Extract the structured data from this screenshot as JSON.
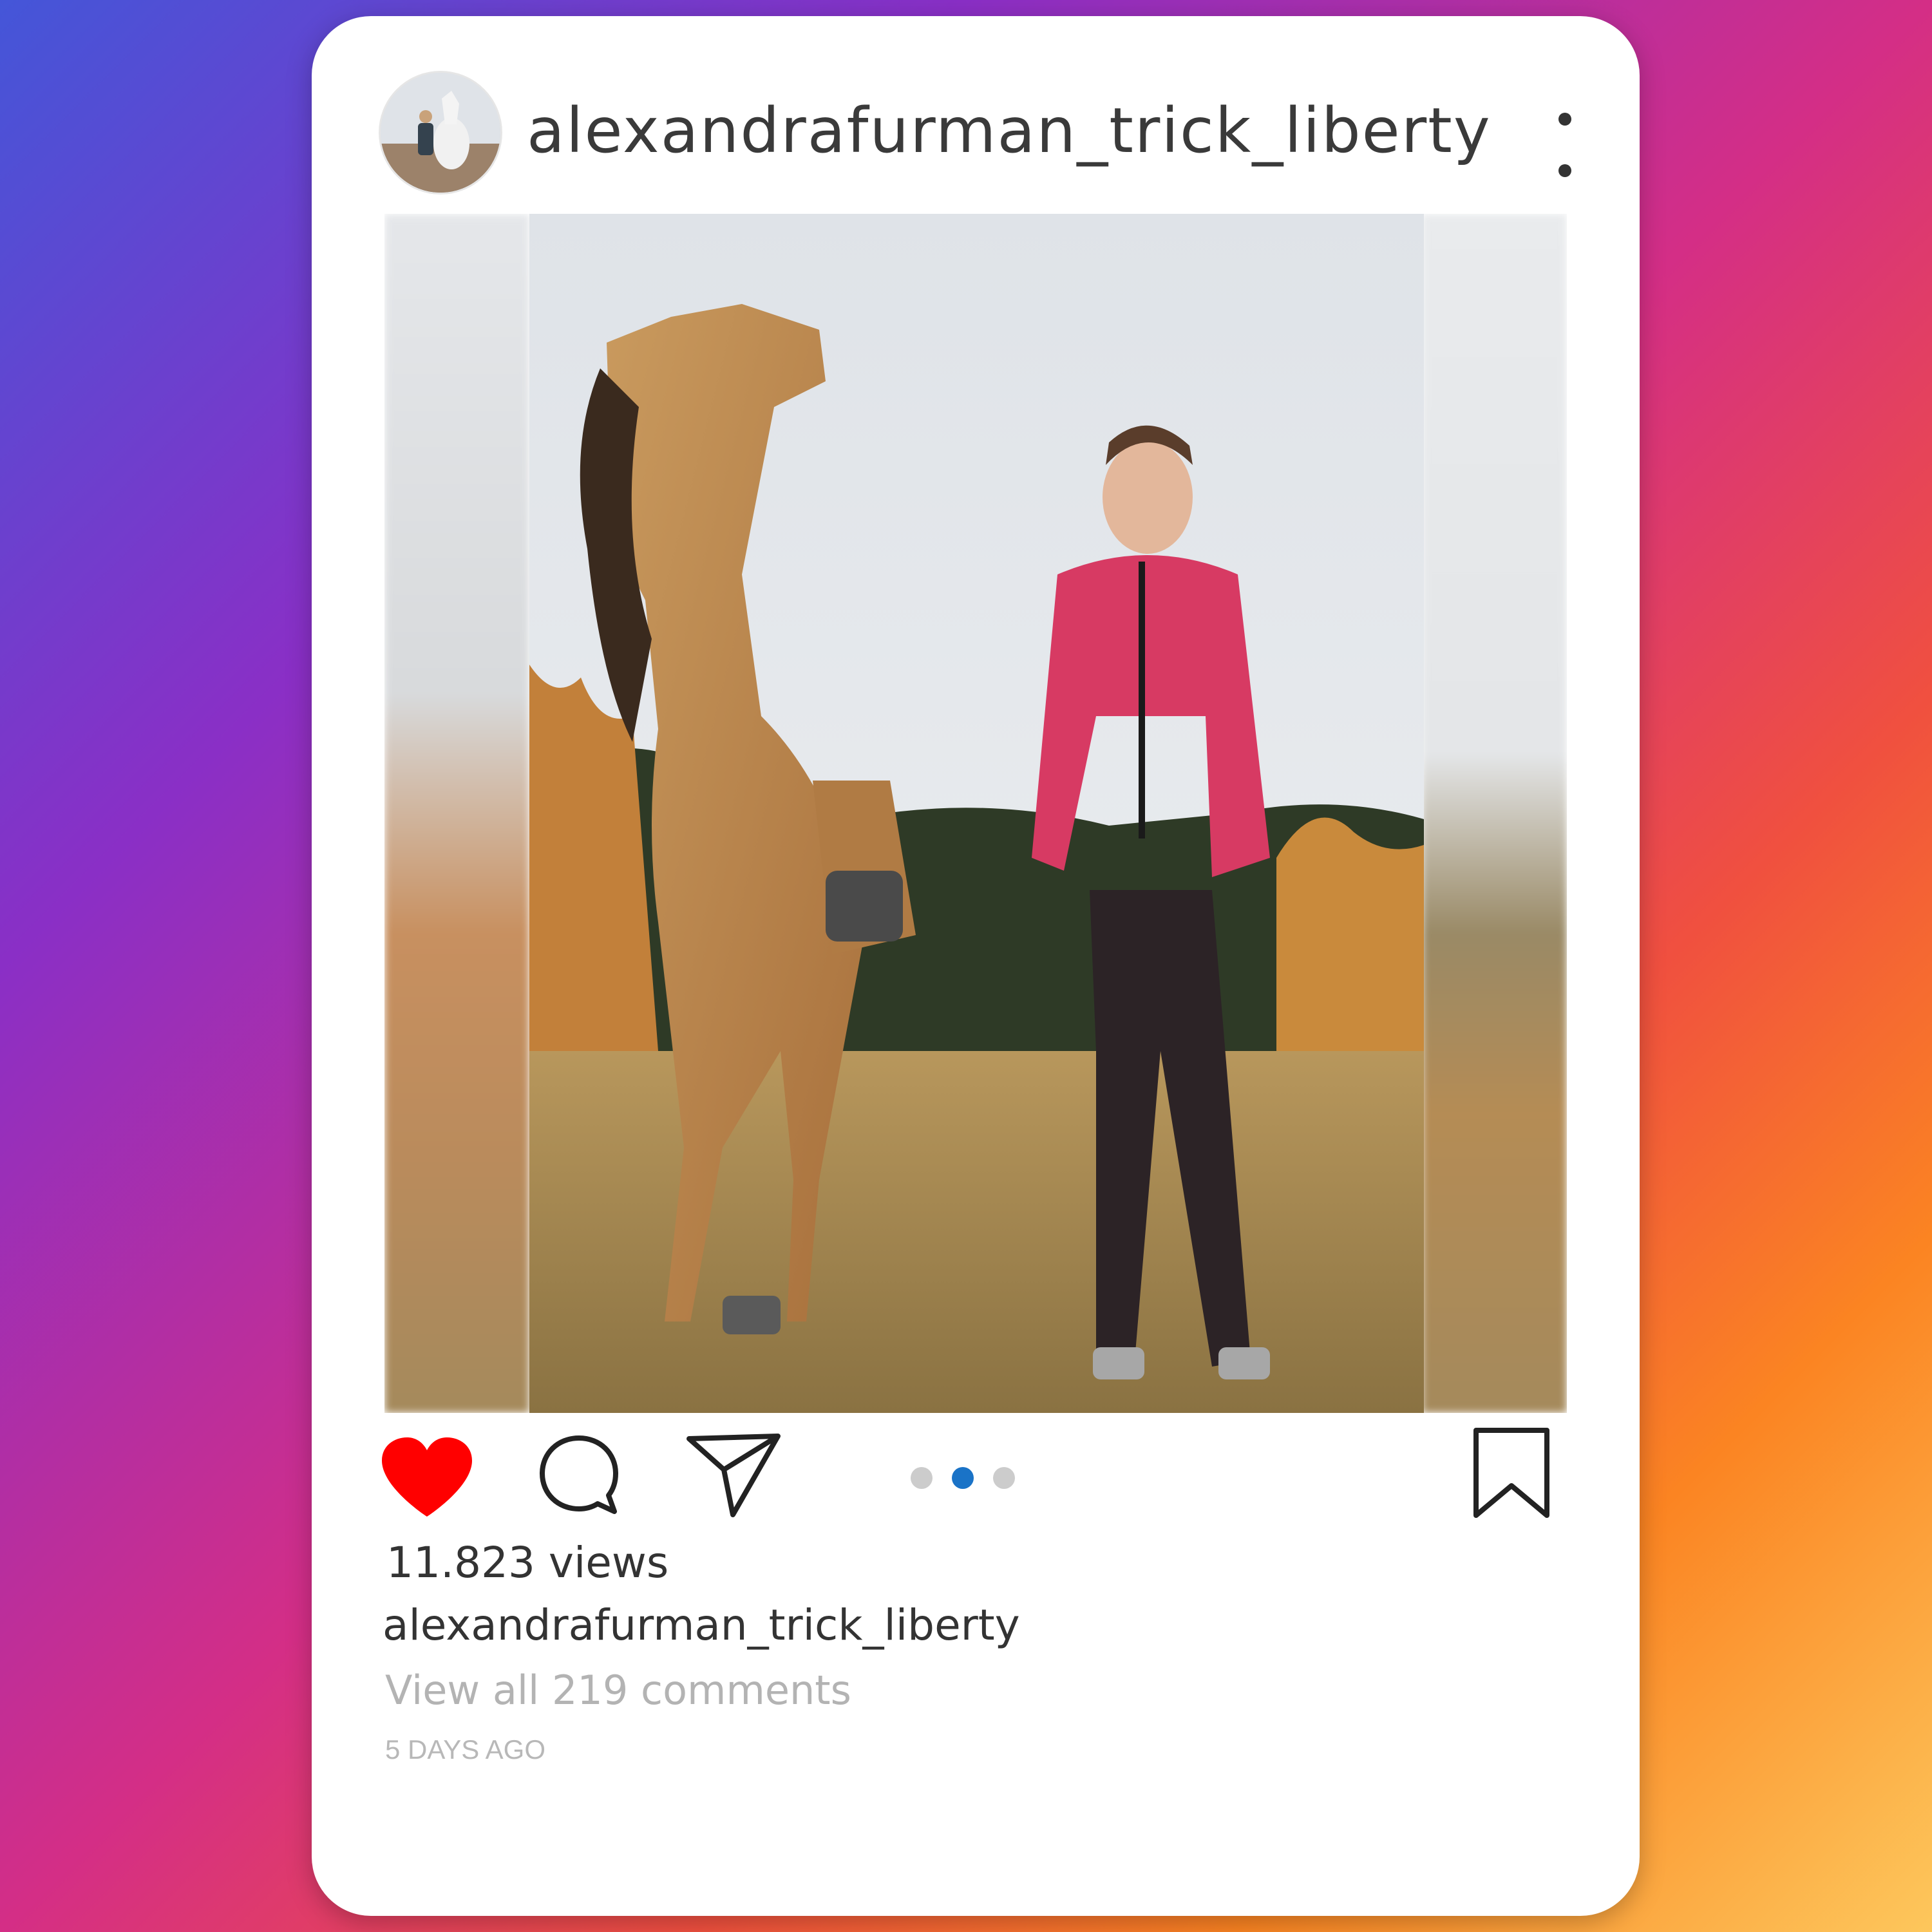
{
  "post": {
    "username": "alexandrafurman_trick_liberty",
    "views": "11.823 views",
    "caption_username": "alexandrafurman_trick_liberty",
    "comments_link": "View all 219 comments",
    "timestamp": "5 DAYS AGO"
  },
  "carousel": {
    "total": 3,
    "active_index": 1
  },
  "icons": {
    "avatar": "profile-avatar",
    "more": "more-options-icon",
    "like": "heart-icon",
    "comment": "comment-icon",
    "share": "paper-plane-icon",
    "bookmark": "bookmark-icon"
  },
  "colors": {
    "like": "#ff0000",
    "carousel_active": "#1a73c7",
    "carousel_inactive": "#cccccc"
  }
}
